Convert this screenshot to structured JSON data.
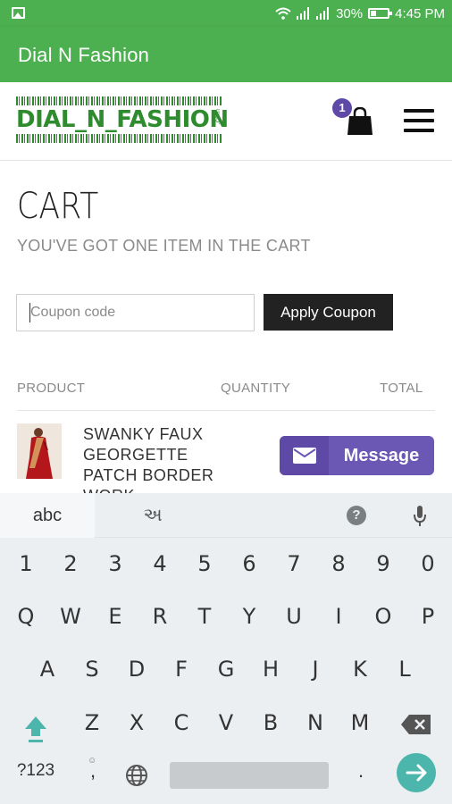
{
  "status_bar": {
    "battery": "30%",
    "time": "4:45 PM"
  },
  "app_bar": {
    "title": "Dial N Fashion"
  },
  "header": {
    "logo_text": "DIAL_N_FASHION",
    "logo_suffix": ".com",
    "cart_count": "1"
  },
  "cart": {
    "title": "CART",
    "subtitle": "YOU'VE GOT ONE ITEM IN THE CART",
    "coupon_placeholder": "Coupon code",
    "apply_label": "Apply Coupon",
    "columns": {
      "product": "PRODUCT",
      "quantity": "QUANTITY",
      "total": "TOTAL"
    },
    "item": {
      "name": "SWANKY FAUX GEORGETTE PATCH BORDER WORK"
    },
    "message_label": "Message"
  },
  "keyboard": {
    "tab_abc": "abc",
    "tab_gujarati": "અ",
    "row_numbers": [
      "1",
      "2",
      "3",
      "4",
      "5",
      "6",
      "7",
      "8",
      "9",
      "0"
    ],
    "row1": [
      "Q",
      "W",
      "E",
      "R",
      "T",
      "Y",
      "U",
      "I",
      "O",
      "P"
    ],
    "row2": [
      "A",
      "S",
      "D",
      "F",
      "G",
      "H",
      "J",
      "K",
      "L"
    ],
    "row3": [
      "Z",
      "X",
      "C",
      "V",
      "B",
      "N",
      "M"
    ],
    "symbols_label": "?123",
    "comma": ",",
    "period": ".",
    "help": "?"
  },
  "colors": {
    "brand_green": "#4caf50",
    "badge_purple": "#5e4aa6",
    "message_purple": "#6b57b4",
    "enter_teal": "#4db6ac"
  }
}
